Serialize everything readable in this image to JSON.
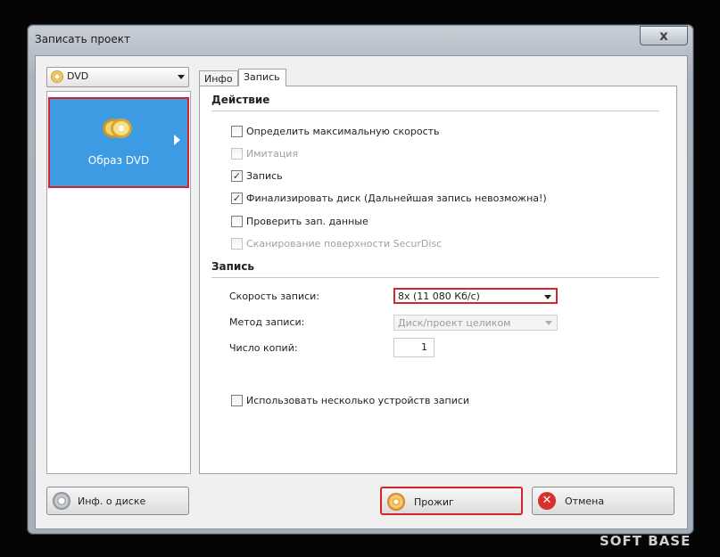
{
  "window": {
    "title": "Записать проект",
    "close_label": "x"
  },
  "device_select": {
    "value": "DVD"
  },
  "left_panel": {
    "format_label": "Образ DVD"
  },
  "tabs": [
    {
      "label": "Инфо"
    },
    {
      "label": "Запись"
    }
  ],
  "action_section": {
    "title": "Действие",
    "options": [
      {
        "label": "Определить максимальную скорость",
        "checked": false,
        "enabled": true
      },
      {
        "label": "Имитация",
        "checked": false,
        "enabled": false
      },
      {
        "label": "Запись",
        "checked": true,
        "enabled": true
      },
      {
        "label": "Финализировать диск (Дальнейшая запись невозможна!)",
        "checked": true,
        "enabled": true
      },
      {
        "label": "Проверить зап. данные",
        "checked": false,
        "enabled": true
      },
      {
        "label": "Сканирование поверхности SecurDisc",
        "checked": false,
        "enabled": false
      }
    ]
  },
  "record_section": {
    "title": "Запись",
    "speed_label": "Скорость записи:",
    "speed_value": "8x (11 080 Кб/с)",
    "method_label": "Метод записи:",
    "method_value": "Диск/проект целиком",
    "copies_label": "Число копий:",
    "copies_value": "1",
    "multi_device_label": "Использовать несколько устройств записи",
    "multi_device_checked": false
  },
  "buttons": {
    "disc_info": "Инф. о диске",
    "burn": "Прожиг",
    "cancel": "Отмена"
  },
  "watermark": "SOFT BASE",
  "colors": {
    "selection": "#3c9be3",
    "highlight_border": "#d3262c"
  }
}
